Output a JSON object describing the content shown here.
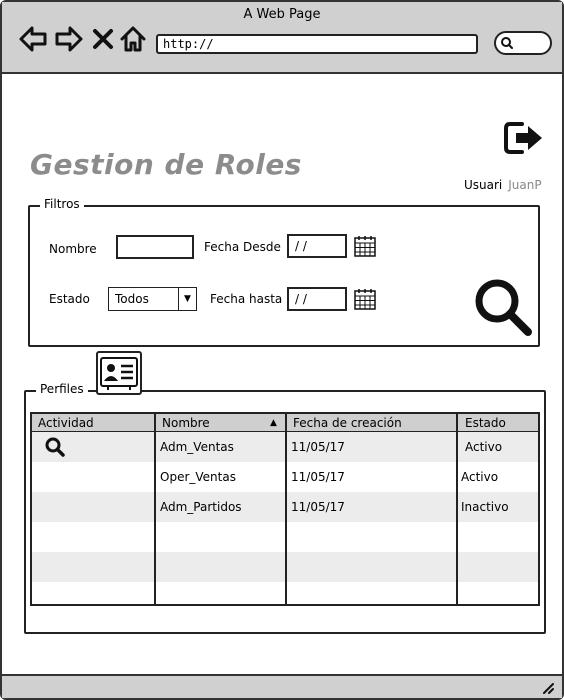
{
  "browser": {
    "title": "A Web Page",
    "url": "http://",
    "nav_icons": [
      "back-arrow-icon",
      "forward-arrow-icon",
      "close-x-icon",
      "home-icon"
    ]
  },
  "header": {
    "title": "Gestion de Roles",
    "user_label": "Usuari",
    "user_name": "JuanP"
  },
  "filters": {
    "legend": "Filtros",
    "nombre_label": "Nombre",
    "nombre_value": "",
    "fecha_desde_label": "Fecha Desde",
    "fecha_desde_value": "/ /",
    "estado_label": "Estado",
    "estado_value": "Todos",
    "fecha_hasta_label": "Fecha hasta",
    "fecha_hasta_value": "/ /"
  },
  "profiles": {
    "legend": "Perfiles",
    "columns": [
      "Actividad",
      "Nombre",
      "Fecha de creación",
      "Estado"
    ],
    "sorted_column": "Nombre",
    "rows": [
      {
        "actividad_icon": "search-icon",
        "nombre": "Adm_Ventas",
        "fecha": "11/05/17",
        "estado": "Activo"
      },
      {
        "actividad_icon": "",
        "nombre": "Oper_Ventas",
        "fecha": "11/05/17",
        "estado": "Activo"
      },
      {
        "actividad_icon": "",
        "nombre": "Adm_Partidos",
        "fecha": "11/05/17",
        "estado": "Inactivo"
      }
    ]
  },
  "colors": {
    "chrome_gray": "#d0d0d0",
    "title_gray": "#8c8c8c",
    "row_alt": "#ececec"
  }
}
